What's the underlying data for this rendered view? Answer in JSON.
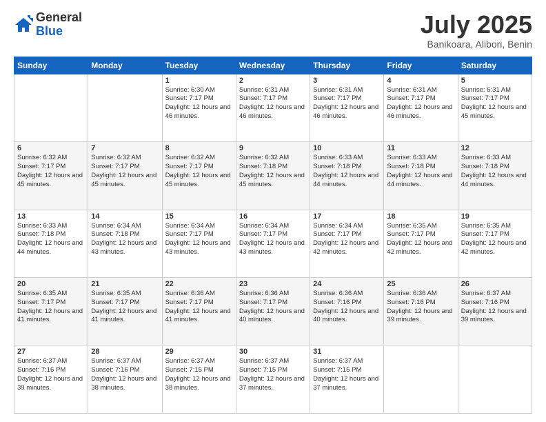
{
  "logo": {
    "general": "General",
    "blue": "Blue"
  },
  "title": {
    "month_year": "July 2025",
    "location": "Banikoara, Alibori, Benin"
  },
  "weekdays": [
    "Sunday",
    "Monday",
    "Tuesday",
    "Wednesday",
    "Thursday",
    "Friday",
    "Saturday"
  ],
  "weeks": [
    [
      {
        "day": "",
        "info": ""
      },
      {
        "day": "",
        "info": ""
      },
      {
        "day": "1",
        "info": "Sunrise: 6:30 AM\nSunset: 7:17 PM\nDaylight: 12 hours and 46 minutes."
      },
      {
        "day": "2",
        "info": "Sunrise: 6:31 AM\nSunset: 7:17 PM\nDaylight: 12 hours and 46 minutes."
      },
      {
        "day": "3",
        "info": "Sunrise: 6:31 AM\nSunset: 7:17 PM\nDaylight: 12 hours and 46 minutes."
      },
      {
        "day": "4",
        "info": "Sunrise: 6:31 AM\nSunset: 7:17 PM\nDaylight: 12 hours and 46 minutes."
      },
      {
        "day": "5",
        "info": "Sunrise: 6:31 AM\nSunset: 7:17 PM\nDaylight: 12 hours and 45 minutes."
      }
    ],
    [
      {
        "day": "6",
        "info": "Sunrise: 6:32 AM\nSunset: 7:17 PM\nDaylight: 12 hours and 45 minutes."
      },
      {
        "day": "7",
        "info": "Sunrise: 6:32 AM\nSunset: 7:17 PM\nDaylight: 12 hours and 45 minutes."
      },
      {
        "day": "8",
        "info": "Sunrise: 6:32 AM\nSunset: 7:17 PM\nDaylight: 12 hours and 45 minutes."
      },
      {
        "day": "9",
        "info": "Sunrise: 6:32 AM\nSunset: 7:18 PM\nDaylight: 12 hours and 45 minutes."
      },
      {
        "day": "10",
        "info": "Sunrise: 6:33 AM\nSunset: 7:18 PM\nDaylight: 12 hours and 44 minutes."
      },
      {
        "day": "11",
        "info": "Sunrise: 6:33 AM\nSunset: 7:18 PM\nDaylight: 12 hours and 44 minutes."
      },
      {
        "day": "12",
        "info": "Sunrise: 6:33 AM\nSunset: 7:18 PM\nDaylight: 12 hours and 44 minutes."
      }
    ],
    [
      {
        "day": "13",
        "info": "Sunrise: 6:33 AM\nSunset: 7:18 PM\nDaylight: 12 hours and 44 minutes."
      },
      {
        "day": "14",
        "info": "Sunrise: 6:34 AM\nSunset: 7:18 PM\nDaylight: 12 hours and 43 minutes."
      },
      {
        "day": "15",
        "info": "Sunrise: 6:34 AM\nSunset: 7:17 PM\nDaylight: 12 hours and 43 minutes."
      },
      {
        "day": "16",
        "info": "Sunrise: 6:34 AM\nSunset: 7:17 PM\nDaylight: 12 hours and 43 minutes."
      },
      {
        "day": "17",
        "info": "Sunrise: 6:34 AM\nSunset: 7:17 PM\nDaylight: 12 hours and 42 minutes."
      },
      {
        "day": "18",
        "info": "Sunrise: 6:35 AM\nSunset: 7:17 PM\nDaylight: 12 hours and 42 minutes."
      },
      {
        "day": "19",
        "info": "Sunrise: 6:35 AM\nSunset: 7:17 PM\nDaylight: 12 hours and 42 minutes."
      }
    ],
    [
      {
        "day": "20",
        "info": "Sunrise: 6:35 AM\nSunset: 7:17 PM\nDaylight: 12 hours and 41 minutes."
      },
      {
        "day": "21",
        "info": "Sunrise: 6:35 AM\nSunset: 7:17 PM\nDaylight: 12 hours and 41 minutes."
      },
      {
        "day": "22",
        "info": "Sunrise: 6:36 AM\nSunset: 7:17 PM\nDaylight: 12 hours and 41 minutes."
      },
      {
        "day": "23",
        "info": "Sunrise: 6:36 AM\nSunset: 7:17 PM\nDaylight: 12 hours and 40 minutes."
      },
      {
        "day": "24",
        "info": "Sunrise: 6:36 AM\nSunset: 7:16 PM\nDaylight: 12 hours and 40 minutes."
      },
      {
        "day": "25",
        "info": "Sunrise: 6:36 AM\nSunset: 7:16 PM\nDaylight: 12 hours and 39 minutes."
      },
      {
        "day": "26",
        "info": "Sunrise: 6:37 AM\nSunset: 7:16 PM\nDaylight: 12 hours and 39 minutes."
      }
    ],
    [
      {
        "day": "27",
        "info": "Sunrise: 6:37 AM\nSunset: 7:16 PM\nDaylight: 12 hours and 39 minutes."
      },
      {
        "day": "28",
        "info": "Sunrise: 6:37 AM\nSunset: 7:16 PM\nDaylight: 12 hours and 38 minutes."
      },
      {
        "day": "29",
        "info": "Sunrise: 6:37 AM\nSunset: 7:15 PM\nDaylight: 12 hours and 38 minutes."
      },
      {
        "day": "30",
        "info": "Sunrise: 6:37 AM\nSunset: 7:15 PM\nDaylight: 12 hours and 37 minutes."
      },
      {
        "day": "31",
        "info": "Sunrise: 6:37 AM\nSunset: 7:15 PM\nDaylight: 12 hours and 37 minutes."
      },
      {
        "day": "",
        "info": ""
      },
      {
        "day": "",
        "info": ""
      }
    ]
  ]
}
